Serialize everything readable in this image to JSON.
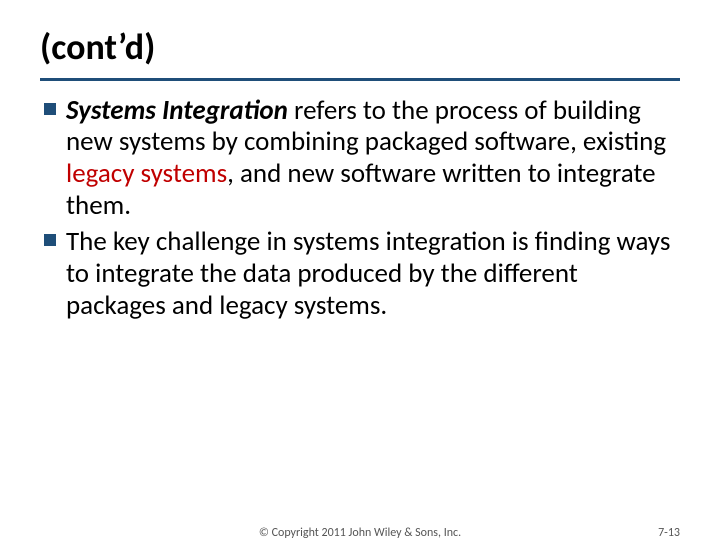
{
  "slide": {
    "title": "(cont’d)",
    "bullets": [
      {
        "lead_bold_italic": "Systems Integration",
        "mid1": " refers to the process of building new systems by combining packaged software, existing ",
        "legacy": "legacy systems",
        "mid2": ", and new software written to integrate them."
      },
      {
        "text": "The key challenge in systems integration is finding ways to integrate the data produced by the different packages and legacy systems."
      }
    ],
    "copyright": "© Copyright 2011 John Wiley & Sons, Inc.",
    "page_number": "7-13"
  }
}
